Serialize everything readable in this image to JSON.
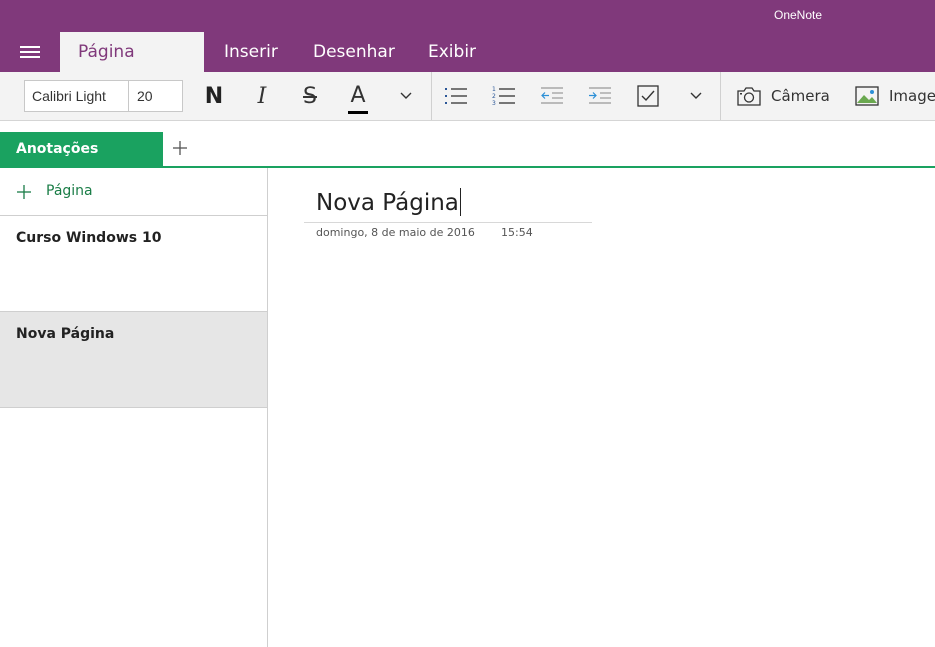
{
  "app": {
    "title": "OneNote"
  },
  "tabs": [
    {
      "label": "Página Inicial",
      "active": true
    },
    {
      "label": "Inserir"
    },
    {
      "label": "Desenhar"
    },
    {
      "label": "Exibir"
    }
  ],
  "ribbon": {
    "font_name": "Calibri Light",
    "font_size": "20",
    "bold_glyph": "N",
    "italic_glyph": "I",
    "strike_glyph": "S",
    "color_glyph": "A",
    "camera_label": "Câmera",
    "image_label": "Imagem"
  },
  "section": {
    "name": "Anotações Rápidas"
  },
  "pagelist": {
    "add_label": "Página",
    "pages": [
      {
        "title": "Curso Windows 10"
      },
      {
        "title": "Nova Página",
        "selected": true
      }
    ]
  },
  "page": {
    "title": "Nova Página",
    "date": "domingo, 8 de maio de 2016",
    "time": "15:54"
  },
  "colors": {
    "brand": "#80397b",
    "section": "#1aa260",
    "ribbon_bg": "#f3f3f3"
  }
}
